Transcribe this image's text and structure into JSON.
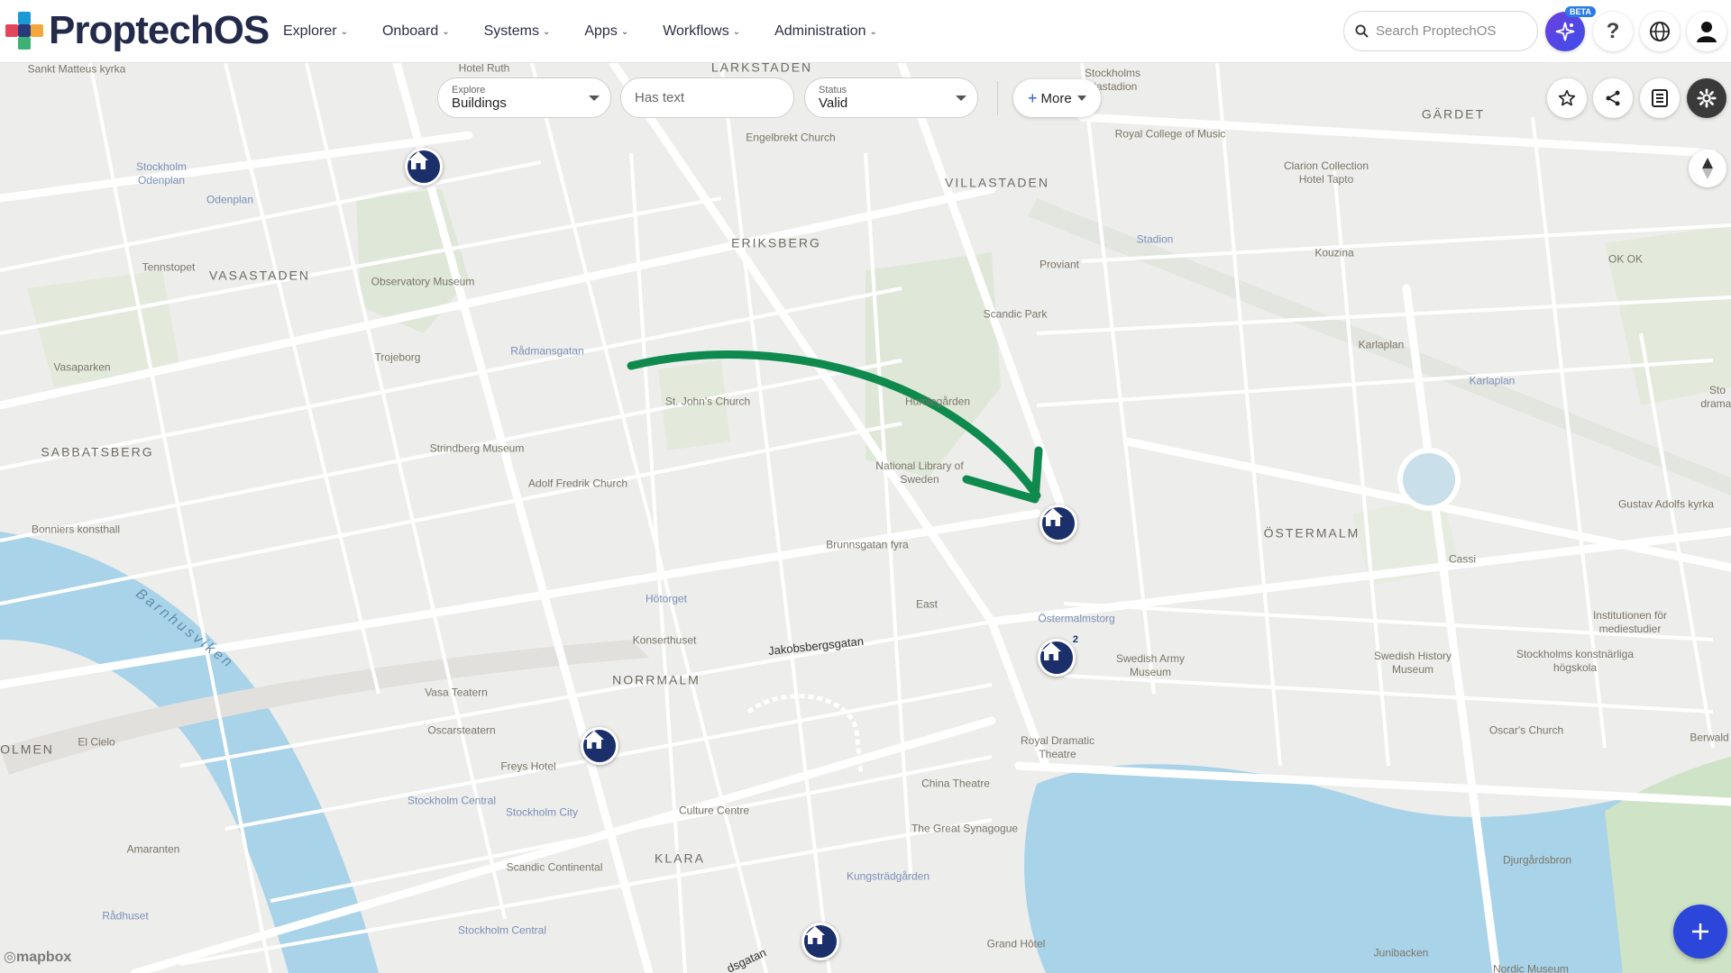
{
  "app": {
    "name": "ProptechOS",
    "beta_badge": "BETA"
  },
  "nav": {
    "items": [
      {
        "label": "Explorer"
      },
      {
        "label": "Onboard"
      },
      {
        "label": "Systems"
      },
      {
        "label": "Apps"
      },
      {
        "label": "Workflows"
      },
      {
        "label": "Administration"
      }
    ]
  },
  "search": {
    "placeholder": "Search ProptechOS",
    "value": ""
  },
  "filters": {
    "explore": {
      "label": "Explore",
      "value": "Buildings"
    },
    "text": {
      "placeholder": "Has text"
    },
    "status": {
      "label": "Status",
      "value": "Valid"
    },
    "more": {
      "label": "More"
    }
  },
  "map": {
    "attribution": "mapbox",
    "districts": [
      "LÄRKSTADEN",
      "GÄRDET",
      "VILLASTADEN",
      "ERIKSBERG",
      "VASASTADEN",
      "SABBATSBERG",
      "ÖSTERMALM",
      "NORRMALM",
      "KLARA",
      "OLMEN"
    ],
    "water": [
      "Barnhusviken"
    ],
    "streets": [
      "Jakobsbergsgatan",
      "dsgatan"
    ],
    "transit": [
      "Stockholm Odenplan",
      "Odenplan",
      "Rådmansgatan",
      "Stadion",
      "Karlaplan",
      "Hötorget",
      "Östermalmstorg",
      "Stockholm Central",
      "Stockholm City",
      "Rådhuset",
      "Kungsträdgården"
    ],
    "places": [
      "Sankt Matteus kyrka",
      "Hotel Ruth",
      "Stockholms piastadion",
      "Engelbrekt Church",
      "Royal College of Music",
      "Clarion Collection Hotel Tapto",
      "Proviant",
      "Kouzina",
      "OK OK",
      "Tennstopet",
      "Observatory Museum",
      "Scandic Park",
      "Karlaplan",
      "Vasaparken",
      "Trojeborg",
      "St. John's Church",
      "Humlegården",
      "Strindberg Museum",
      "National Library of Sweden",
      "Adolf Fredrik Church",
      "Gustav Adolfs kyrka",
      "Bonniers konsthall",
      "Brunnsgatan fyra",
      "Cassi",
      "East",
      "Konserthuset",
      "Swedish Army Museum",
      "Swedish History Museum",
      "Institutionen för mediestudier",
      "Stockholms konstnärliga högskola",
      "Vasa Teatern",
      "Oscarsteatern",
      "El Cielo",
      "Freys Hotel",
      "Royal Dramatic Theatre",
      "Oscar's Church",
      "Berwald",
      "China Theatre",
      "Culture Centre",
      "The Great Synagogue",
      "Amaranten",
      "Scandic Continental",
      "Djurgårdsbron",
      "Grand Hôtel",
      "Junibacken",
      "Nordic Museum",
      "Sto dramat"
    ],
    "pins": [
      {
        "name": "building",
        "count": ""
      },
      {
        "name": "building",
        "count": ""
      },
      {
        "name": "building",
        "count": ""
      },
      {
        "name": "building",
        "count": "2"
      },
      {
        "name": "building",
        "count": ""
      },
      {
        "name": "building",
        "count": ""
      }
    ],
    "annotation_arrow_color": "#0f8a4f",
    "pin_color": "#1b2f6b"
  },
  "icons": {
    "search": "search-icon",
    "ai": "ai-assistant-icon",
    "help": "help-icon",
    "globe": "globe-icon",
    "user": "user-icon",
    "star": "star-icon",
    "share": "share-icon",
    "list": "list-icon",
    "settings": "gear-icon",
    "compass": "compass-icon",
    "add": "plus-icon"
  },
  "colors": {
    "accent": "#2b46d9",
    "brand_navy": "#232a4a"
  }
}
